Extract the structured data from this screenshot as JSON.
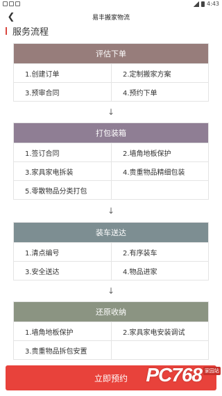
{
  "status_bar": {
    "time": "4:43"
  },
  "nav": {
    "title": "易丰搬家物流"
  },
  "section_title": "服务流程",
  "colors": {
    "accent": "#d9463f",
    "stage1": "#977d7b",
    "stage2": "#8f7e94",
    "stage3": "#7d8e92",
    "stage4": "#8b9482",
    "cta": "#e8423b"
  },
  "stages": [
    {
      "title": "评估下单",
      "items": [
        "1.创建订单",
        "2.定制搬家方案",
        "3.预审合同",
        "4.预约下单"
      ]
    },
    {
      "title": "打包装箱",
      "items": [
        "1.签订合同",
        "2.墙角地板保护",
        "3.家具家电拆装",
        "4.贵重物品精细包装",
        "5.零散物品分类打包",
        ""
      ]
    },
    {
      "title": "装车送达",
      "items": [
        "1.清点编号",
        "2.有序装车",
        "3.安全送达",
        "4.物品进家"
      ]
    },
    {
      "title": "还原收纳",
      "items": [
        "1.墙角地板保护",
        "2.家具家电安装调试",
        "3.贵重物品拆包安置",
        ""
      ]
    }
  ],
  "cta": {
    "label": "立即预约"
  },
  "watermark": {
    "text": "PC768",
    "sub": "家园站"
  }
}
